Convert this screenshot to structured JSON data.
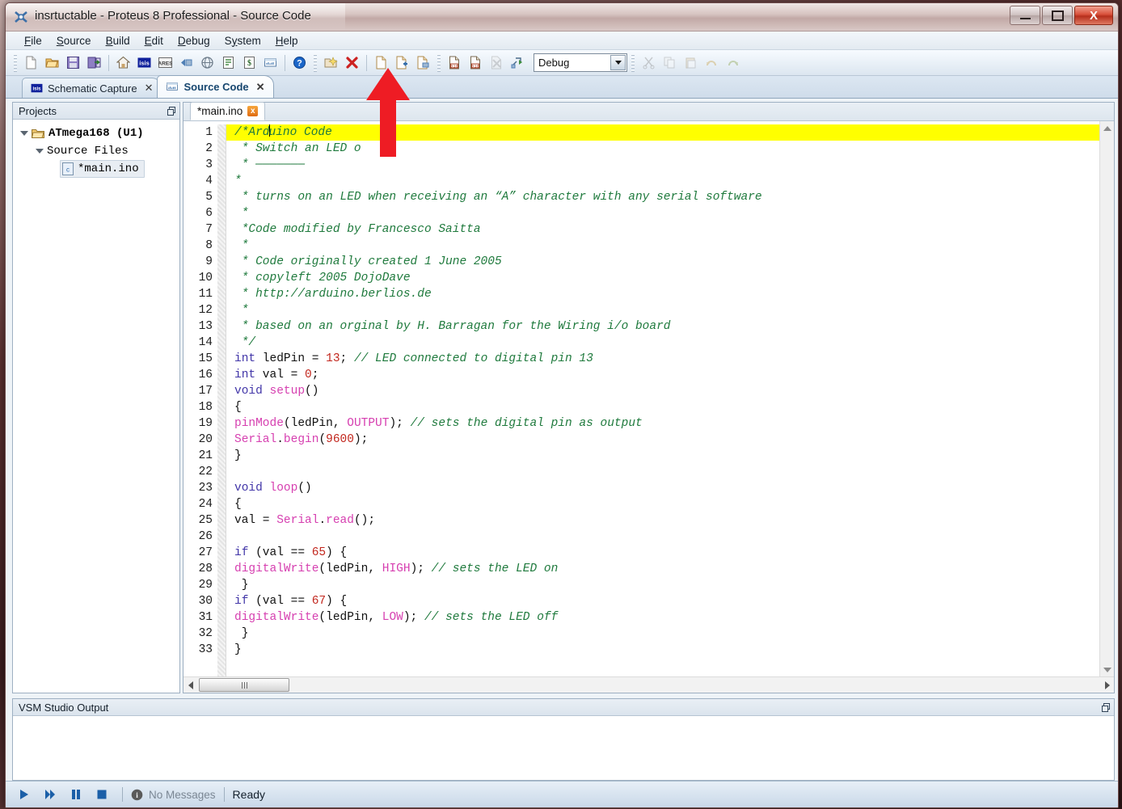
{
  "window": {
    "title": "insrtuctable - Proteus 8 Professional - Source Code",
    "app_icon": "proteus-icon",
    "minimize_label": "Minimize",
    "maximize_label": "Maximize",
    "close_label": "X"
  },
  "menubar": {
    "items": [
      {
        "name": "file",
        "accel": "F",
        "rest": "ile"
      },
      {
        "name": "source",
        "accel": "S",
        "rest": "ource"
      },
      {
        "name": "build",
        "accel": "B",
        "rest": "uild"
      },
      {
        "name": "edit",
        "accel": "E",
        "rest": "dit"
      },
      {
        "name": "debug",
        "accel": "D",
        "rest": "ebug"
      },
      {
        "name": "system",
        "accel": "y",
        "pre": "S",
        "rest": "stem"
      },
      {
        "name": "help",
        "accel": "H",
        "rest": "elp"
      }
    ]
  },
  "toolbar": {
    "groups": [
      [
        "new-file-icon",
        "open-folder-icon",
        "save-icon",
        "save-exit-icon"
      ],
      [
        "home-icon",
        "isis-icon",
        "ares-icon",
        "back-design-icon",
        "3d-view-icon",
        "bill-of-materials-icon",
        "design-explorer-icon",
        "vsm-studio-icon"
      ],
      [
        "help-icon"
      ],
      [
        "open-project-icon",
        "close-project-icon"
      ],
      [
        "new-source-icon",
        "add-file-icon",
        "print-source-icon"
      ],
      [
        "build-project-icon",
        "rebuild-project-icon",
        "clean-project-icon",
        "project-settings-icon"
      ]
    ],
    "config_combo": {
      "value": "Debug",
      "name": "build-configuration-select"
    }
  },
  "module_tabs": [
    {
      "label": "Schematic Capture",
      "icon": "isis-icon",
      "active": false
    },
    {
      "label": "Source Code",
      "icon": "vsm-studio-icon",
      "active": true
    }
  ],
  "projects": {
    "panel_title": "Projects",
    "tree": [
      {
        "label": "ATmega168 (U1)",
        "level": 1,
        "icon": "folder-icon",
        "expanded": true,
        "bold": true
      },
      {
        "label": "Source Files",
        "level": 2,
        "icon": "none",
        "expanded": true,
        "bold": false
      },
      {
        "label": "*main.ino",
        "level": 3,
        "icon": "c-file-icon",
        "selected": true,
        "bold": false
      }
    ]
  },
  "editor": {
    "file_tab": {
      "label": "*main.ino",
      "close": "x"
    },
    "active_line": 1,
    "lines": [
      {
        "n": 1,
        "tokens": [
          {
            "t": "/*Arduino Code",
            "c": "cmt"
          }
        ],
        "highlight": true,
        "caret_after": 5
      },
      {
        "n": 2,
        "tokens": [
          {
            "t": " * Switch an LED o",
            "c": "cmt"
          }
        ]
      },
      {
        "n": 3,
        "tokens": [
          {
            "t": " * ———————",
            "c": "cmt"
          }
        ]
      },
      {
        "n": 4,
        "tokens": [
          {
            "t": "*",
            "c": "cmt"
          }
        ]
      },
      {
        "n": 5,
        "tokens": [
          {
            "t": " * turns on an LED when receiving an “A” character with any serial software",
            "c": "cmt"
          }
        ]
      },
      {
        "n": 6,
        "tokens": [
          {
            "t": " *",
            "c": "cmt"
          }
        ]
      },
      {
        "n": 7,
        "tokens": [
          {
            "t": " *Code modified by Francesco Saitta",
            "c": "cmt"
          }
        ]
      },
      {
        "n": 8,
        "tokens": [
          {
            "t": " *",
            "c": "cmt"
          }
        ]
      },
      {
        "n": 9,
        "tokens": [
          {
            "t": " * Code originally created 1 June 2005",
            "c": "cmt"
          }
        ]
      },
      {
        "n": 10,
        "tokens": [
          {
            "t": " * copyleft 2005 DojoDave",
            "c": "cmt"
          }
        ]
      },
      {
        "n": 11,
        "tokens": [
          {
            "t": " * http://arduino.berlios.de",
            "c": "cmt"
          }
        ]
      },
      {
        "n": 12,
        "tokens": [
          {
            "t": " *",
            "c": "cmt"
          }
        ]
      },
      {
        "n": 13,
        "tokens": [
          {
            "t": " * based on an orginal by H. Barragan for the Wiring i/o board",
            "c": "cmt"
          }
        ]
      },
      {
        "n": 14,
        "tokens": [
          {
            "t": " */",
            "c": "cmt"
          }
        ]
      },
      {
        "n": 15,
        "tokens": [
          {
            "t": "int",
            "c": "kw"
          },
          {
            "t": " ledPin = ",
            "c": "pl"
          },
          {
            "t": "13",
            "c": "num"
          },
          {
            "t": "; ",
            "c": "pl"
          },
          {
            "t": "// LED connected to digital pin 13",
            "c": "cmt"
          }
        ]
      },
      {
        "n": 16,
        "tokens": [
          {
            "t": "int",
            "c": "kw"
          },
          {
            "t": " val = ",
            "c": "pl"
          },
          {
            "t": "0",
            "c": "num"
          },
          {
            "t": ";",
            "c": "pl"
          }
        ]
      },
      {
        "n": 17,
        "tokens": [
          {
            "t": "void",
            "c": "kw"
          },
          {
            "t": " ",
            "c": "pl"
          },
          {
            "t": "setup",
            "c": "fn"
          },
          {
            "t": "()",
            "c": "pl"
          }
        ]
      },
      {
        "n": 18,
        "tokens": [
          {
            "t": "{",
            "c": "pl"
          }
        ]
      },
      {
        "n": 19,
        "tokens": [
          {
            "t": "pinMode",
            "c": "fn"
          },
          {
            "t": "(ledPin, ",
            "c": "pl"
          },
          {
            "t": "OUTPUT",
            "c": "fn"
          },
          {
            "t": "); ",
            "c": "pl"
          },
          {
            "t": "// sets the digital pin as output",
            "c": "cmt"
          }
        ]
      },
      {
        "n": 20,
        "tokens": [
          {
            "t": "Serial",
            "c": "fn"
          },
          {
            "t": ".",
            "c": "pl"
          },
          {
            "t": "begin",
            "c": "fn"
          },
          {
            "t": "(",
            "c": "pl"
          },
          {
            "t": "9600",
            "c": "num"
          },
          {
            "t": ");",
            "c": "pl"
          }
        ]
      },
      {
        "n": 21,
        "tokens": [
          {
            "t": "}",
            "c": "pl"
          }
        ]
      },
      {
        "n": 22,
        "tokens": [
          {
            "t": "",
            "c": "pl"
          }
        ]
      },
      {
        "n": 23,
        "tokens": [
          {
            "t": "void",
            "c": "kw"
          },
          {
            "t": " ",
            "c": "pl"
          },
          {
            "t": "loop",
            "c": "fn"
          },
          {
            "t": "()",
            "c": "pl"
          }
        ]
      },
      {
        "n": 24,
        "tokens": [
          {
            "t": "{",
            "c": "pl"
          }
        ]
      },
      {
        "n": 25,
        "tokens": [
          {
            "t": "val = ",
            "c": "pl"
          },
          {
            "t": "Serial",
            "c": "fn"
          },
          {
            "t": ".",
            "c": "pl"
          },
          {
            "t": "read",
            "c": "fn"
          },
          {
            "t": "();",
            "c": "pl"
          }
        ]
      },
      {
        "n": 26,
        "tokens": [
          {
            "t": "",
            "c": "pl"
          }
        ]
      },
      {
        "n": 27,
        "tokens": [
          {
            "t": "if",
            "c": "kw"
          },
          {
            "t": " (val == ",
            "c": "pl"
          },
          {
            "t": "65",
            "c": "num"
          },
          {
            "t": ") {",
            "c": "pl"
          }
        ]
      },
      {
        "n": 28,
        "tokens": [
          {
            "t": "digitalWrite",
            "c": "fn"
          },
          {
            "t": "(ledPin, ",
            "c": "pl"
          },
          {
            "t": "HIGH",
            "c": "fn"
          },
          {
            "t": "); ",
            "c": "pl"
          },
          {
            "t": "// sets the LED on",
            "c": "cmt"
          }
        ]
      },
      {
        "n": 29,
        "tokens": [
          {
            "t": " }",
            "c": "pl"
          }
        ]
      },
      {
        "n": 30,
        "tokens": [
          {
            "t": "if",
            "c": "kw"
          },
          {
            "t": " (val == ",
            "c": "pl"
          },
          {
            "t": "67",
            "c": "num"
          },
          {
            "t": ") {",
            "c": "pl"
          }
        ]
      },
      {
        "n": 31,
        "tokens": [
          {
            "t": "digitalWrite",
            "c": "fn"
          },
          {
            "t": "(ledPin, ",
            "c": "pl"
          },
          {
            "t": "LOW",
            "c": "fn"
          },
          {
            "t": "); ",
            "c": "pl"
          },
          {
            "t": "// sets the LED off",
            "c": "cmt"
          }
        ]
      },
      {
        "n": 32,
        "tokens": [
          {
            "t": " }",
            "c": "pl"
          }
        ]
      },
      {
        "n": 33,
        "tokens": [
          {
            "t": "}",
            "c": "pl"
          }
        ]
      }
    ]
  },
  "output_panel": {
    "title": "VSM Studio Output",
    "content": ""
  },
  "statusbar": {
    "buttons": [
      "run-button",
      "step-button",
      "pause-button",
      "stop-button"
    ],
    "messages_label": "No Messages",
    "status_label": "Ready"
  },
  "annotation": {
    "arrow": "red-up-arrow",
    "color": "#ee1c24"
  },
  "colors": {
    "comment": "#1f7a3d",
    "keyword": "#4236a8",
    "function": "#d63fb0",
    "number": "#c2271e",
    "highlight_line": "#ffff00",
    "accent": "#16466e"
  }
}
